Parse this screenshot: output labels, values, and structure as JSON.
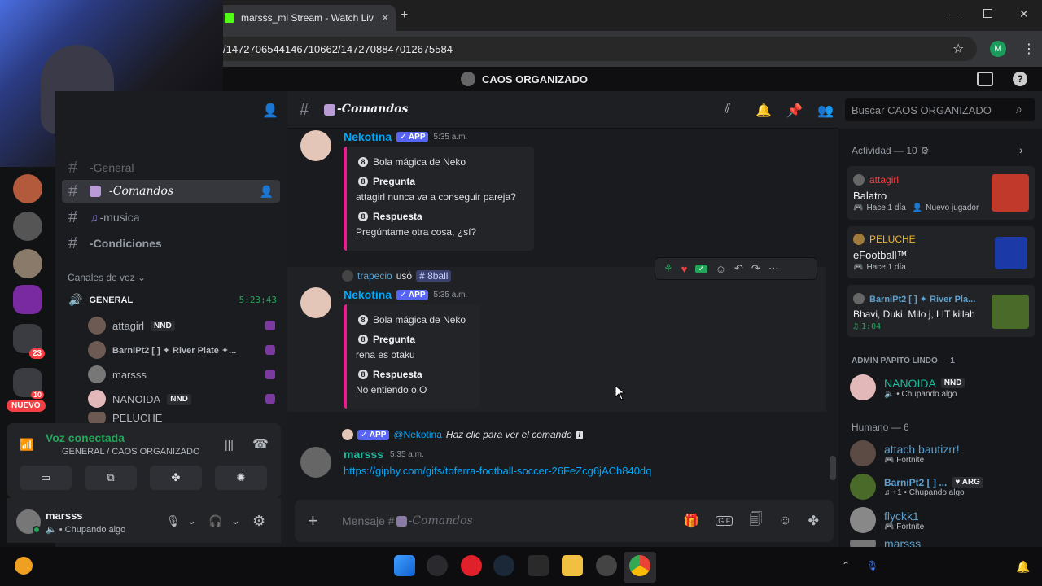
{
  "browser": {
    "tab_title": "marsss_ml Stream - Watch Live",
    "url": "/1472706544146710662/1472708847012675584",
    "profile_initial": "M"
  },
  "server": {
    "name": "CAOS ORGANIZADO"
  },
  "rail": {
    "mention_badge": "23",
    "new_label": "NUEVO",
    "small_badge": "10"
  },
  "channels": {
    "items": [
      {
        "label": "-General"
      },
      {
        "label": "-Comandos"
      },
      {
        "label": "-musica"
      },
      {
        "label": "-Condiciones"
      }
    ],
    "voice_category": "Canales de voz",
    "voice_channel": "GENERAL",
    "voice_timer": "5:23:43",
    "voice_users": [
      {
        "name": "attagirl",
        "tag": "NND"
      },
      {
        "name": "BarniPt2 [ ] ✦ River Plate ✦..."
      },
      {
        "name": "marsss"
      },
      {
        "name": "NANOIDA",
        "tag": "NND"
      },
      {
        "name": "PELUCHE"
      }
    ]
  },
  "voice": {
    "status": "Voz conectada",
    "location": "GENERAL / CAOS ORGANIZADO"
  },
  "user": {
    "name": "marsss",
    "status": "Chupando algo"
  },
  "channel_header": {
    "name": "-Comandos",
    "search_placeholder": "Buscar CAOS ORGANIZADO"
  },
  "messages": [
    {
      "author": "Nekotina",
      "badge": "APP",
      "time": "5:35 a.m.",
      "embed_title": "Bola mágica de Neko",
      "q_label": "Pregunta",
      "question": "attagirl nunca va a conseguir pareja?",
      "a_label": "Respuesta",
      "answer": "Pregúntame otra cosa, ¿sí?"
    },
    {
      "reply_user": "trapecio",
      "reply_used": "usó",
      "reply_cmd": "8ball",
      "author": "Nekotina",
      "badge": "APP",
      "time": "5:35 a.m.",
      "embed_title": "Bola mágica de Neko",
      "q_label": "Pregunta",
      "question": "rena es otaku",
      "a_label": "Respuesta",
      "answer": "No entiendo o.O"
    },
    {
      "reply_badge": "APP",
      "reply_user": "@Nekotina",
      "reply_text": "Haz clic para ver el comando",
      "author": "marsss",
      "time": "5:35 a.m.",
      "link": "https://giphy.com/gifs/toferra-football-soccer-26FeZcg6jACh840dq"
    }
  ],
  "composer": {
    "placeholder": "Mensaje #",
    "channel": "-Comandos"
  },
  "activity": {
    "header": "Actividad — 10",
    "cards": [
      {
        "user": "attagirl",
        "game": "Balatro",
        "meta1": "Hace 1 día",
        "meta2": "Nuevo jugador"
      },
      {
        "user": "PELUCHE",
        "game": "eFootball™",
        "meta1": "Hace 1 día"
      },
      {
        "user": "BarniPt2 [ ] ✦ River Pla...",
        "game": "Bhavi, Duki, Milo j, LIT killah",
        "meta1": "1:04"
      }
    ]
  },
  "members": {
    "admin_header": "ADMIN PAPITO LINDO — 1",
    "admin": [
      {
        "name": "NANOIDA",
        "tag": "NND",
        "status": "Chupando algo"
      }
    ],
    "human_header": "Humano — 6",
    "humans": [
      {
        "name": "attach bautizrr!",
        "status": "Fortnite"
      },
      {
        "name": "BarniPt2 [ ] ...",
        "tag": "ARG",
        "status": "+1 • Chupando algo"
      },
      {
        "name": "flyckk1",
        "status": "Fortnite"
      },
      {
        "name": "marsss"
      }
    ]
  },
  "colors": {
    "accent": "#5865f2",
    "bot_name": "#00a8fc",
    "embed_bar": "#e91e8c",
    "online": "#23a55a"
  }
}
